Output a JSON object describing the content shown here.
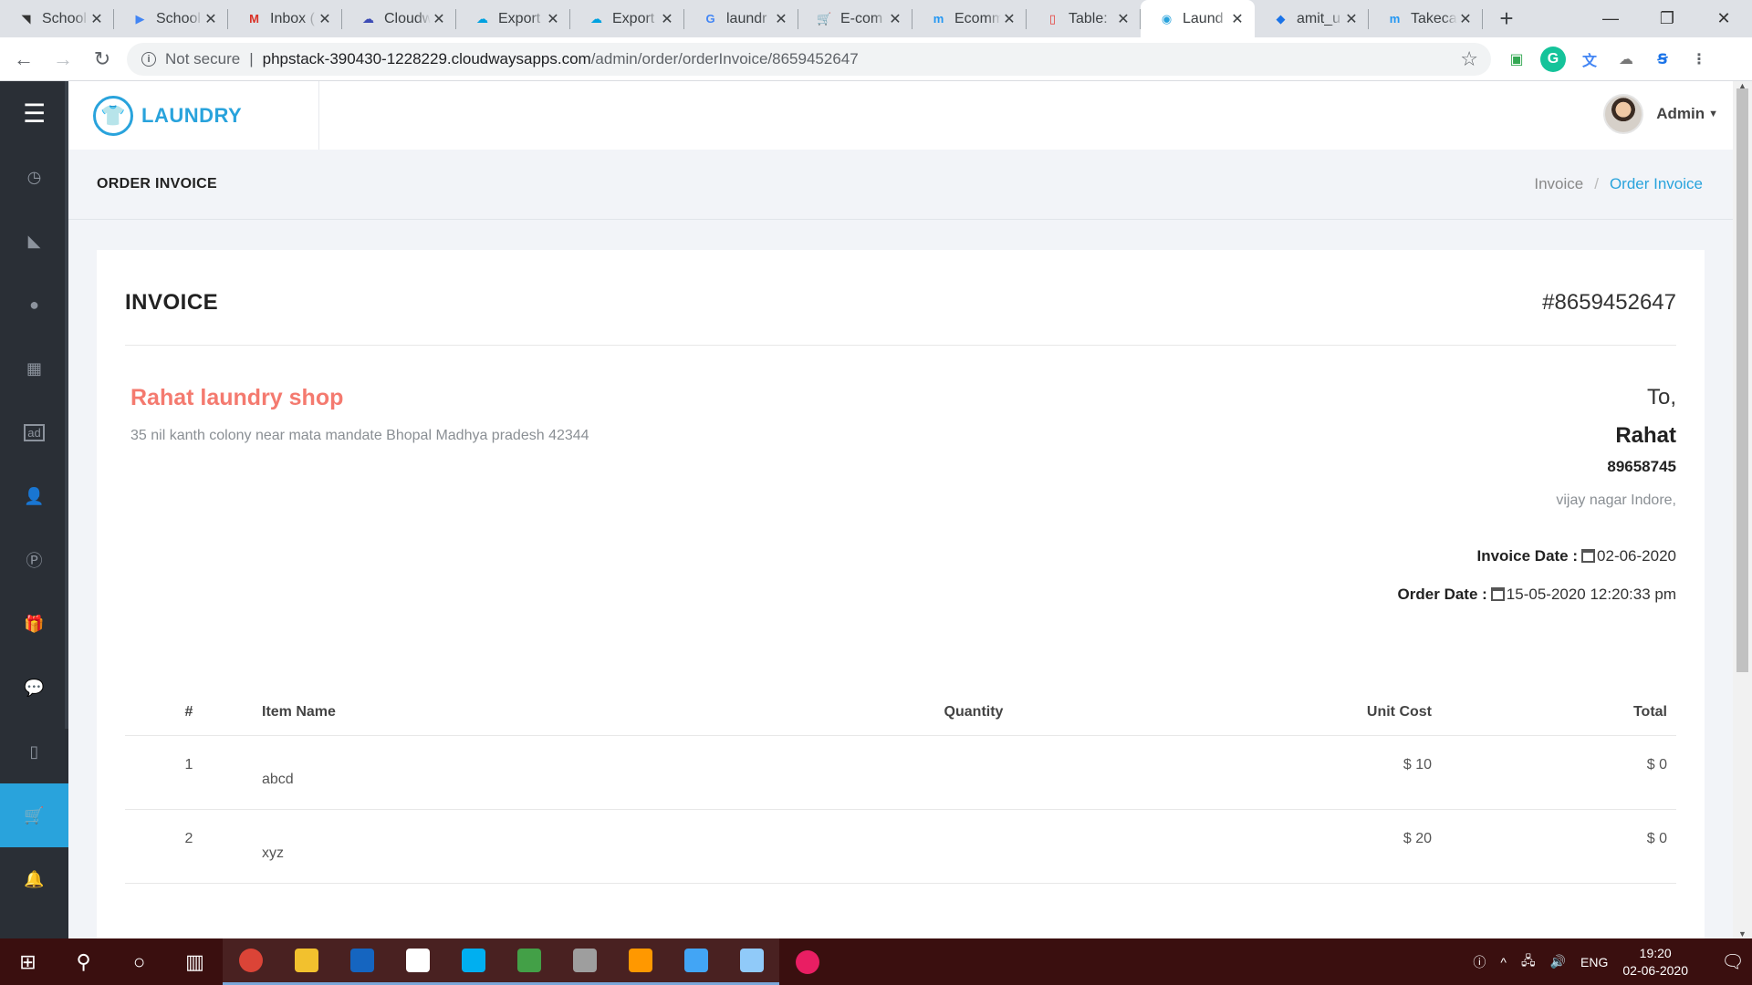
{
  "browser": {
    "tabs": [
      {
        "title": "School",
        "icon": "code-icon",
        "color": "#333333",
        "glyph": "◥"
      },
      {
        "title": "School",
        "icon": "play-icon",
        "color": "#4285f4",
        "glyph": "▶"
      },
      {
        "title": "Inbox (",
        "icon": "gmail-icon",
        "color": "#d93025",
        "glyph": "M"
      },
      {
        "title": "Cloudw",
        "icon": "cloud-icon",
        "color": "#3c4bb5",
        "glyph": "☁"
      },
      {
        "title": "Export",
        "icon": "salesforce-icon",
        "color": "#00a1e0",
        "glyph": "☁"
      },
      {
        "title": "Export",
        "icon": "salesforce-icon",
        "color": "#00a1e0",
        "glyph": "☁"
      },
      {
        "title": "laundr",
        "icon": "google-icon",
        "color": "#4285f4",
        "glyph": "G"
      },
      {
        "title": "E-com",
        "icon": "cart-icon",
        "color": "#1e88e5",
        "glyph": "🛒"
      },
      {
        "title": "Ecomm",
        "icon": "m-icon",
        "color": "#2196f3",
        "glyph": "m"
      },
      {
        "title": "Table:",
        "icon": "table-icon",
        "color": "#e53935",
        "glyph": "▯"
      },
      {
        "title": "Laund",
        "icon": "laundry-icon",
        "color": "#29a3dc",
        "glyph": "◉",
        "active": true
      },
      {
        "title": "amit_u",
        "icon": "shield-icon",
        "color": "#1a73e8",
        "glyph": "◆"
      },
      {
        "title": "Takeca",
        "icon": "m-icon",
        "color": "#2196f3",
        "glyph": "m"
      }
    ],
    "new_tab": "+",
    "url_not_secure": "Not secure",
    "url_host": "phpstack-390430-1228229.cloudwaysapps.com",
    "url_path": "/admin/order/orderInvoice/8659452647"
  },
  "app": {
    "brand": "LAUNDRY",
    "user": "Admin",
    "sidebar": [
      {
        "name": "sidebar-dashboard",
        "icon": "gauge-icon",
        "glyph": "◷"
      },
      {
        "name": "sidebar-services",
        "icon": "triangle-icon",
        "glyph": "◣"
      },
      {
        "name": "sidebar-users",
        "icon": "user-icon",
        "glyph": "●"
      },
      {
        "name": "sidebar-layout",
        "icon": "grid-icon",
        "glyph": "▦"
      },
      {
        "name": "sidebar-ads",
        "icon": "ad-icon",
        "glyph": "ad"
      },
      {
        "name": "sidebar-add-user",
        "icon": "user-plus-icon",
        "glyph": "👤"
      },
      {
        "name": "sidebar-payments",
        "icon": "p-circle-icon",
        "glyph": "Ⓟ"
      },
      {
        "name": "sidebar-gifts",
        "icon": "gift-icon",
        "glyph": "🎁"
      },
      {
        "name": "sidebar-messages",
        "icon": "chat-icon",
        "glyph": "💬"
      },
      {
        "name": "sidebar-mobile",
        "icon": "mobile-icon",
        "glyph": "▯"
      },
      {
        "name": "sidebar-orders",
        "icon": "cart-icon",
        "glyph": "🛒",
        "active": true
      },
      {
        "name": "sidebar-notifications",
        "icon": "bell-icon",
        "glyph": "🔔"
      }
    ],
    "page_title": "ORDER INVOICE",
    "breadcrumb": {
      "parent": "Invoice",
      "separator": "/",
      "current": "Order Invoice"
    }
  },
  "invoice": {
    "title": "INVOICE",
    "number": "#8659452647",
    "shop_name": "Rahat laundry shop",
    "shop_address": "35 nil kanth colony near mata mandate Bhopal Madhya pradesh 42344",
    "to_label": "To,",
    "customer_name": "Rahat",
    "customer_phone": "89658745",
    "customer_address": "vijay nagar Indore,",
    "invoice_date_label": "Invoice Date :",
    "invoice_date": "02-06-2020",
    "order_date_label": "Order Date :",
    "order_date": "15-05-2020 12:20:33 pm",
    "columns": [
      "#",
      "Item Name",
      "Quantity",
      "Unit Cost",
      "Total"
    ],
    "items": [
      {
        "num": "1",
        "name": "abcd",
        "qty": "",
        "unit": "$ 10",
        "total": "$ 0"
      },
      {
        "num": "2",
        "name": "xyz",
        "qty": "",
        "unit": "$ 20",
        "total": "$ 0"
      }
    ]
  },
  "taskbar": {
    "apps": [
      {
        "name": "chrome",
        "icon": "chrome-icon",
        "color": "#db4437",
        "open": true
      },
      {
        "name": "file-explorer",
        "icon": "folder-icon",
        "color": "#f2c12e",
        "open": true
      },
      {
        "name": "lync",
        "icon": "lync-icon",
        "color": "#1565c0",
        "open": true
      },
      {
        "name": "settings",
        "icon": "gear-icon",
        "color": "#ffffff",
        "open": true
      },
      {
        "name": "skype",
        "icon": "skype-icon",
        "color": "#00aff0",
        "open": true
      },
      {
        "name": "photos",
        "icon": "image-icon",
        "color": "#43a047",
        "open": true
      },
      {
        "name": "app-7",
        "icon": "window-icon",
        "color": "#9e9e9e",
        "open": true
      },
      {
        "name": "sublime",
        "icon": "sublime-icon",
        "color": "#ff9800",
        "open": true
      },
      {
        "name": "network",
        "icon": "network-icon",
        "color": "#42a5f5",
        "open": true
      },
      {
        "name": "remote-desktop",
        "icon": "monitor-icon",
        "color": "#90caf9",
        "open": true
      },
      {
        "name": "itunes",
        "icon": "music-icon",
        "color": "#e91e63",
        "open": false
      }
    ],
    "lang": "ENG",
    "time": "19:20",
    "date": "02-06-2020"
  }
}
